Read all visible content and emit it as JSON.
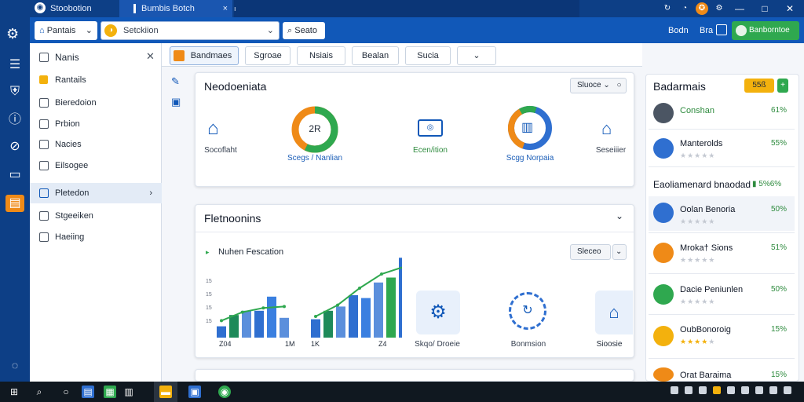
{
  "titlebar": {
    "tab1": "Stoobotion",
    "tab2": "Bumbis Botch",
    "tab3_close": "×",
    "tab2_close": "×"
  },
  "toolbar": {
    "home_label": "Pantais",
    "url_value": "Setckiion",
    "search_label": "Seato",
    "link1": "Bodn",
    "link2": "Bra",
    "user_button": "Banborntoe"
  },
  "nav": {
    "header": "Nanis",
    "items": [
      "Rantails",
      "Bieredoion",
      "Prbion",
      "Nacies",
      "Eilsogee",
      "Pletedon",
      "Stgeeiken",
      "Haeiing"
    ]
  },
  "tabs": [
    "Bandmaes",
    "Sgroae",
    "Nsiais",
    "Bealan",
    "Sucia",
    ""
  ],
  "summary": {
    "title": "Neodoeniata",
    "filter_label": "Sluoce",
    "stat1_label": "Socoflaht",
    "donut1_value": "2R",
    "donut1_label": "Scegs / Nanlian",
    "stat2_label": "Ecen/ition",
    "donut2_label": "Scgg Norpaia",
    "stat3_label": "Seseiiier"
  },
  "chart_panel": {
    "title": "Fletnoonins",
    "subtitle": "Nuhen Fescation",
    "filter_label": "Sleceo",
    "x_ticks": [
      "Z04",
      "1M",
      "1K",
      "Z4"
    ],
    "y_ticks": [
      "15",
      "15",
      "15",
      "15"
    ],
    "widget1": "Skqo/ Droeie",
    "widget2": "Bonmsion",
    "widget3": "Sioosie"
  },
  "chart_data": [
    {
      "type": "bar",
      "values": [
        16,
        32,
        38,
        38,
        58,
        28
      ],
      "line": [
        24,
        36,
        42,
        44
      ]
    },
    {
      "type": "bar",
      "values": [
        26,
        38,
        44,
        60,
        56,
        78,
        85,
        113
      ],
      "line": [
        30,
        46,
        70,
        90,
        100
      ]
    }
  ],
  "right_panel": {
    "title": "Badarmais",
    "badge": "55ß",
    "section2_title": "Eaoliamenard bnaodad",
    "section2_value": "▮ 5%6%",
    "rows": [
      {
        "name": "Conshan",
        "value": "61%",
        "name_color": "#2e8b3e"
      },
      {
        "name": "Manterolds",
        "value": "55%",
        "stars": 0
      },
      {
        "name": "Oolan Benoria",
        "value": "50%",
        "stars": 0
      },
      {
        "name": "Mroka† Sions",
        "value": "51%",
        "stars": 0
      },
      {
        "name": "Dacie Peniunlen",
        "value": "50%",
        "stars": 0
      },
      {
        "name": "OubBonoroig",
        "value": "15%",
        "stars": 4
      },
      {
        "name": "Orat Baraima",
        "value": "15%"
      }
    ]
  },
  "colors": {
    "titlebar": "#0d3f86",
    "toolbar": "#1158b8",
    "accent_green": "#2fa84f",
    "accent_orange": "#ef8a17",
    "accent_blue": "#2f6fd0",
    "accent_yellow": "#f3b10d"
  }
}
